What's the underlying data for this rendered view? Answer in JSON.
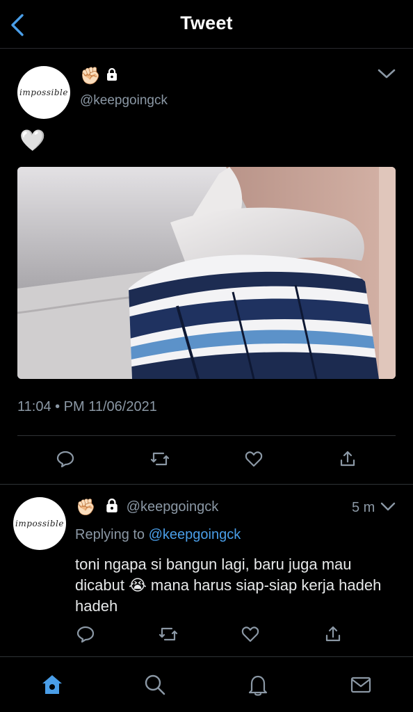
{
  "header": {
    "title": "Tweet"
  },
  "tweet": {
    "avatar_text": "impossible",
    "handle": "@keepgoingck",
    "text": "🤍",
    "timestamp": "11:04 • PM 11/06/2021"
  },
  "reply": {
    "avatar_text": "impossible",
    "handle": "@keepgoingck",
    "time": "5 m",
    "replying_label": "Replying to",
    "replying_to": "@keepgoingck",
    "text_before_emoji": "toni ngapa si bangun lagi, baru juga mau dicabut",
    "emoji": "😭",
    "text_after_emoji": "mana harus siap-siap kerja hadeh hadeh"
  },
  "colors": {
    "accent": "#4a9ee8",
    "muted": "#8b98a5",
    "background": "#000000"
  },
  "icons": {
    "back": "back-arrow-icon",
    "actions": [
      "reply-icon",
      "retweet-icon",
      "like-icon",
      "share-icon"
    ],
    "tabs": [
      "home-icon",
      "search-icon",
      "notifications-icon",
      "messages-icon"
    ]
  }
}
